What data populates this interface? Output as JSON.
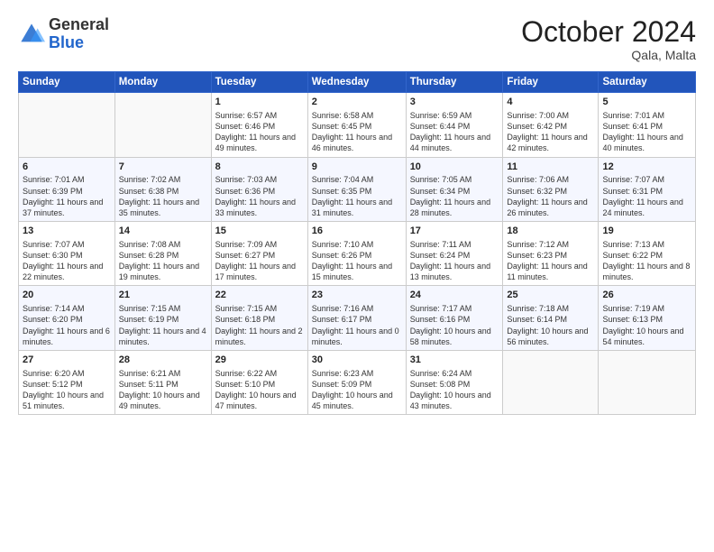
{
  "header": {
    "logo_general": "General",
    "logo_blue": "Blue",
    "month": "October 2024",
    "location": "Qala, Malta"
  },
  "days_of_week": [
    "Sunday",
    "Monday",
    "Tuesday",
    "Wednesday",
    "Thursday",
    "Friday",
    "Saturday"
  ],
  "weeks": [
    [
      {
        "day": "",
        "info": ""
      },
      {
        "day": "",
        "info": ""
      },
      {
        "day": "1",
        "info": "Sunrise: 6:57 AM\nSunset: 6:46 PM\nDaylight: 11 hours and 49 minutes."
      },
      {
        "day": "2",
        "info": "Sunrise: 6:58 AM\nSunset: 6:45 PM\nDaylight: 11 hours and 46 minutes."
      },
      {
        "day": "3",
        "info": "Sunrise: 6:59 AM\nSunset: 6:44 PM\nDaylight: 11 hours and 44 minutes."
      },
      {
        "day": "4",
        "info": "Sunrise: 7:00 AM\nSunset: 6:42 PM\nDaylight: 11 hours and 42 minutes."
      },
      {
        "day": "5",
        "info": "Sunrise: 7:01 AM\nSunset: 6:41 PM\nDaylight: 11 hours and 40 minutes."
      }
    ],
    [
      {
        "day": "6",
        "info": "Sunrise: 7:01 AM\nSunset: 6:39 PM\nDaylight: 11 hours and 37 minutes."
      },
      {
        "day": "7",
        "info": "Sunrise: 7:02 AM\nSunset: 6:38 PM\nDaylight: 11 hours and 35 minutes."
      },
      {
        "day": "8",
        "info": "Sunrise: 7:03 AM\nSunset: 6:36 PM\nDaylight: 11 hours and 33 minutes."
      },
      {
        "day": "9",
        "info": "Sunrise: 7:04 AM\nSunset: 6:35 PM\nDaylight: 11 hours and 31 minutes."
      },
      {
        "day": "10",
        "info": "Sunrise: 7:05 AM\nSunset: 6:34 PM\nDaylight: 11 hours and 28 minutes."
      },
      {
        "day": "11",
        "info": "Sunrise: 7:06 AM\nSunset: 6:32 PM\nDaylight: 11 hours and 26 minutes."
      },
      {
        "day": "12",
        "info": "Sunrise: 7:07 AM\nSunset: 6:31 PM\nDaylight: 11 hours and 24 minutes."
      }
    ],
    [
      {
        "day": "13",
        "info": "Sunrise: 7:07 AM\nSunset: 6:30 PM\nDaylight: 11 hours and 22 minutes."
      },
      {
        "day": "14",
        "info": "Sunrise: 7:08 AM\nSunset: 6:28 PM\nDaylight: 11 hours and 19 minutes."
      },
      {
        "day": "15",
        "info": "Sunrise: 7:09 AM\nSunset: 6:27 PM\nDaylight: 11 hours and 17 minutes."
      },
      {
        "day": "16",
        "info": "Sunrise: 7:10 AM\nSunset: 6:26 PM\nDaylight: 11 hours and 15 minutes."
      },
      {
        "day": "17",
        "info": "Sunrise: 7:11 AM\nSunset: 6:24 PM\nDaylight: 11 hours and 13 minutes."
      },
      {
        "day": "18",
        "info": "Sunrise: 7:12 AM\nSunset: 6:23 PM\nDaylight: 11 hours and 11 minutes."
      },
      {
        "day": "19",
        "info": "Sunrise: 7:13 AM\nSunset: 6:22 PM\nDaylight: 11 hours and 8 minutes."
      }
    ],
    [
      {
        "day": "20",
        "info": "Sunrise: 7:14 AM\nSunset: 6:20 PM\nDaylight: 11 hours and 6 minutes."
      },
      {
        "day": "21",
        "info": "Sunrise: 7:15 AM\nSunset: 6:19 PM\nDaylight: 11 hours and 4 minutes."
      },
      {
        "day": "22",
        "info": "Sunrise: 7:15 AM\nSunset: 6:18 PM\nDaylight: 11 hours and 2 minutes."
      },
      {
        "day": "23",
        "info": "Sunrise: 7:16 AM\nSunset: 6:17 PM\nDaylight: 11 hours and 0 minutes."
      },
      {
        "day": "24",
        "info": "Sunrise: 7:17 AM\nSunset: 6:16 PM\nDaylight: 10 hours and 58 minutes."
      },
      {
        "day": "25",
        "info": "Sunrise: 7:18 AM\nSunset: 6:14 PM\nDaylight: 10 hours and 56 minutes."
      },
      {
        "day": "26",
        "info": "Sunrise: 7:19 AM\nSunset: 6:13 PM\nDaylight: 10 hours and 54 minutes."
      }
    ],
    [
      {
        "day": "27",
        "info": "Sunrise: 6:20 AM\nSunset: 5:12 PM\nDaylight: 10 hours and 51 minutes."
      },
      {
        "day": "28",
        "info": "Sunrise: 6:21 AM\nSunset: 5:11 PM\nDaylight: 10 hours and 49 minutes."
      },
      {
        "day": "29",
        "info": "Sunrise: 6:22 AM\nSunset: 5:10 PM\nDaylight: 10 hours and 47 minutes."
      },
      {
        "day": "30",
        "info": "Sunrise: 6:23 AM\nSunset: 5:09 PM\nDaylight: 10 hours and 45 minutes."
      },
      {
        "day": "31",
        "info": "Sunrise: 6:24 AM\nSunset: 5:08 PM\nDaylight: 10 hours and 43 minutes."
      },
      {
        "day": "",
        "info": ""
      },
      {
        "day": "",
        "info": ""
      }
    ]
  ]
}
